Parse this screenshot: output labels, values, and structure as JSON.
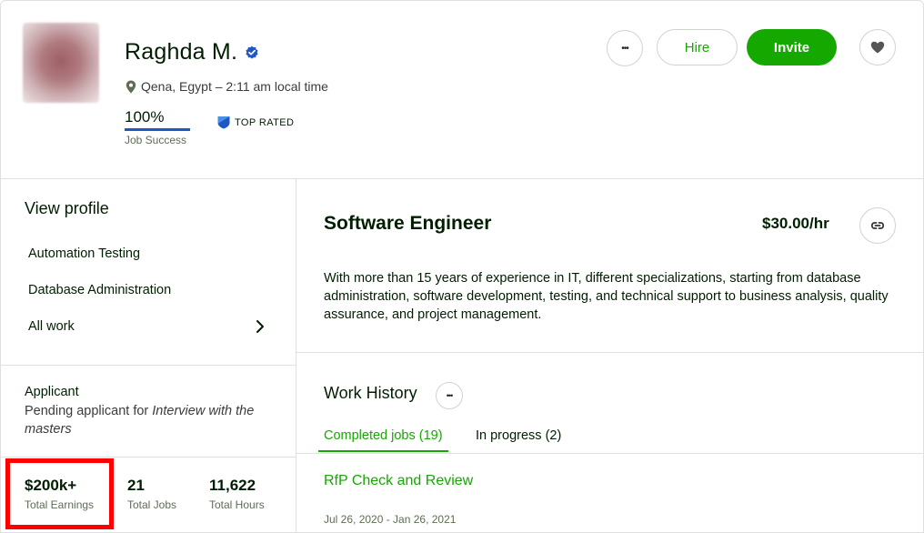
{
  "profile": {
    "name": "Raghda M.",
    "location": "Qena, Egypt – 2:11 am local time",
    "job_success_value": "100%",
    "job_success_label": "Job Success",
    "job_success_fraction": 1.0,
    "badge": "TOP RATED"
  },
  "actions": {
    "hire_label": "Hire",
    "invite_label": "Invite",
    "more_symbol": "•••"
  },
  "sidebar": {
    "view_profile": "View profile",
    "items": [
      {
        "label": "Automation Testing"
      },
      {
        "label": "Database Administration"
      },
      {
        "label": "All work"
      }
    ],
    "applicant_title": "Applicant",
    "applicant_prefix": "Pending applicant for ",
    "applicant_job": "Interview with the masters"
  },
  "stats": [
    {
      "value": "$200k+",
      "label": "Total Earnings"
    },
    {
      "value": "21",
      "label": "Total Jobs"
    },
    {
      "value": "11,622",
      "label": "Total Hours"
    }
  ],
  "main": {
    "title": "Software Engineer",
    "rate": "$30.00/hr",
    "description": "With more than 15 years of experience in IT, different specializations, starting from database administration, software development, testing, and technical support to business analysis, quality assurance, and project management.",
    "work_history_title": "Work History",
    "tabs": [
      {
        "label": "Completed jobs (19)",
        "active": true
      },
      {
        "label": "In progress (2)",
        "active": false
      }
    ],
    "jobs": [
      {
        "title": "RfP Check and Review",
        "dates": "Jul 26, 2020 - Jan 26, 2021"
      }
    ]
  },
  "colors": {
    "brand_green": "#14a800",
    "verified_blue": "#1f57c3",
    "highlight_red": "#ff0000"
  },
  "icons": [
    "verified-icon",
    "location-pin-icon",
    "top-rated-icon",
    "more-icon",
    "heart-icon",
    "link-icon",
    "chevron-right-icon"
  ]
}
